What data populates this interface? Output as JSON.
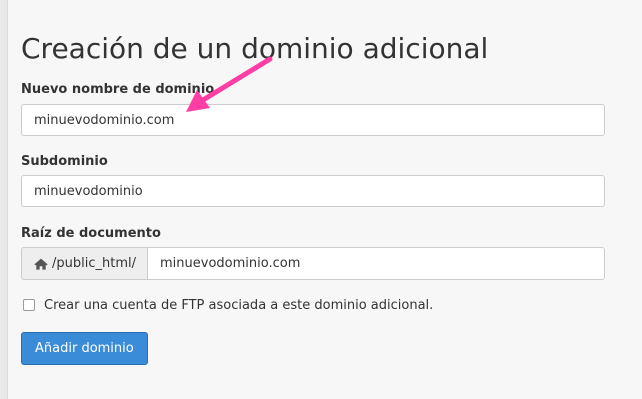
{
  "page": {
    "title": "Creación de un dominio adicional"
  },
  "form": {
    "new_domain": {
      "label": "Nuevo nombre de dominio",
      "value": "minuevodominio.com"
    },
    "subdomain": {
      "label": "Subdominio",
      "value": "minuevodominio"
    },
    "document_root": {
      "label": "Raíz de documento",
      "prefix": "/public_html/",
      "prefix_icon": "home-icon",
      "value": "minuevodominio.com"
    },
    "ftp_account": {
      "label": "Crear una cuenta de FTP asociada a este dominio adicional.",
      "checked": false
    },
    "submit_label": "Añadir dominio"
  },
  "colors": {
    "primary_button": "#3a8bd8",
    "annotation_arrow": "#ff3ea5",
    "page_background": "#f7f7f7"
  }
}
